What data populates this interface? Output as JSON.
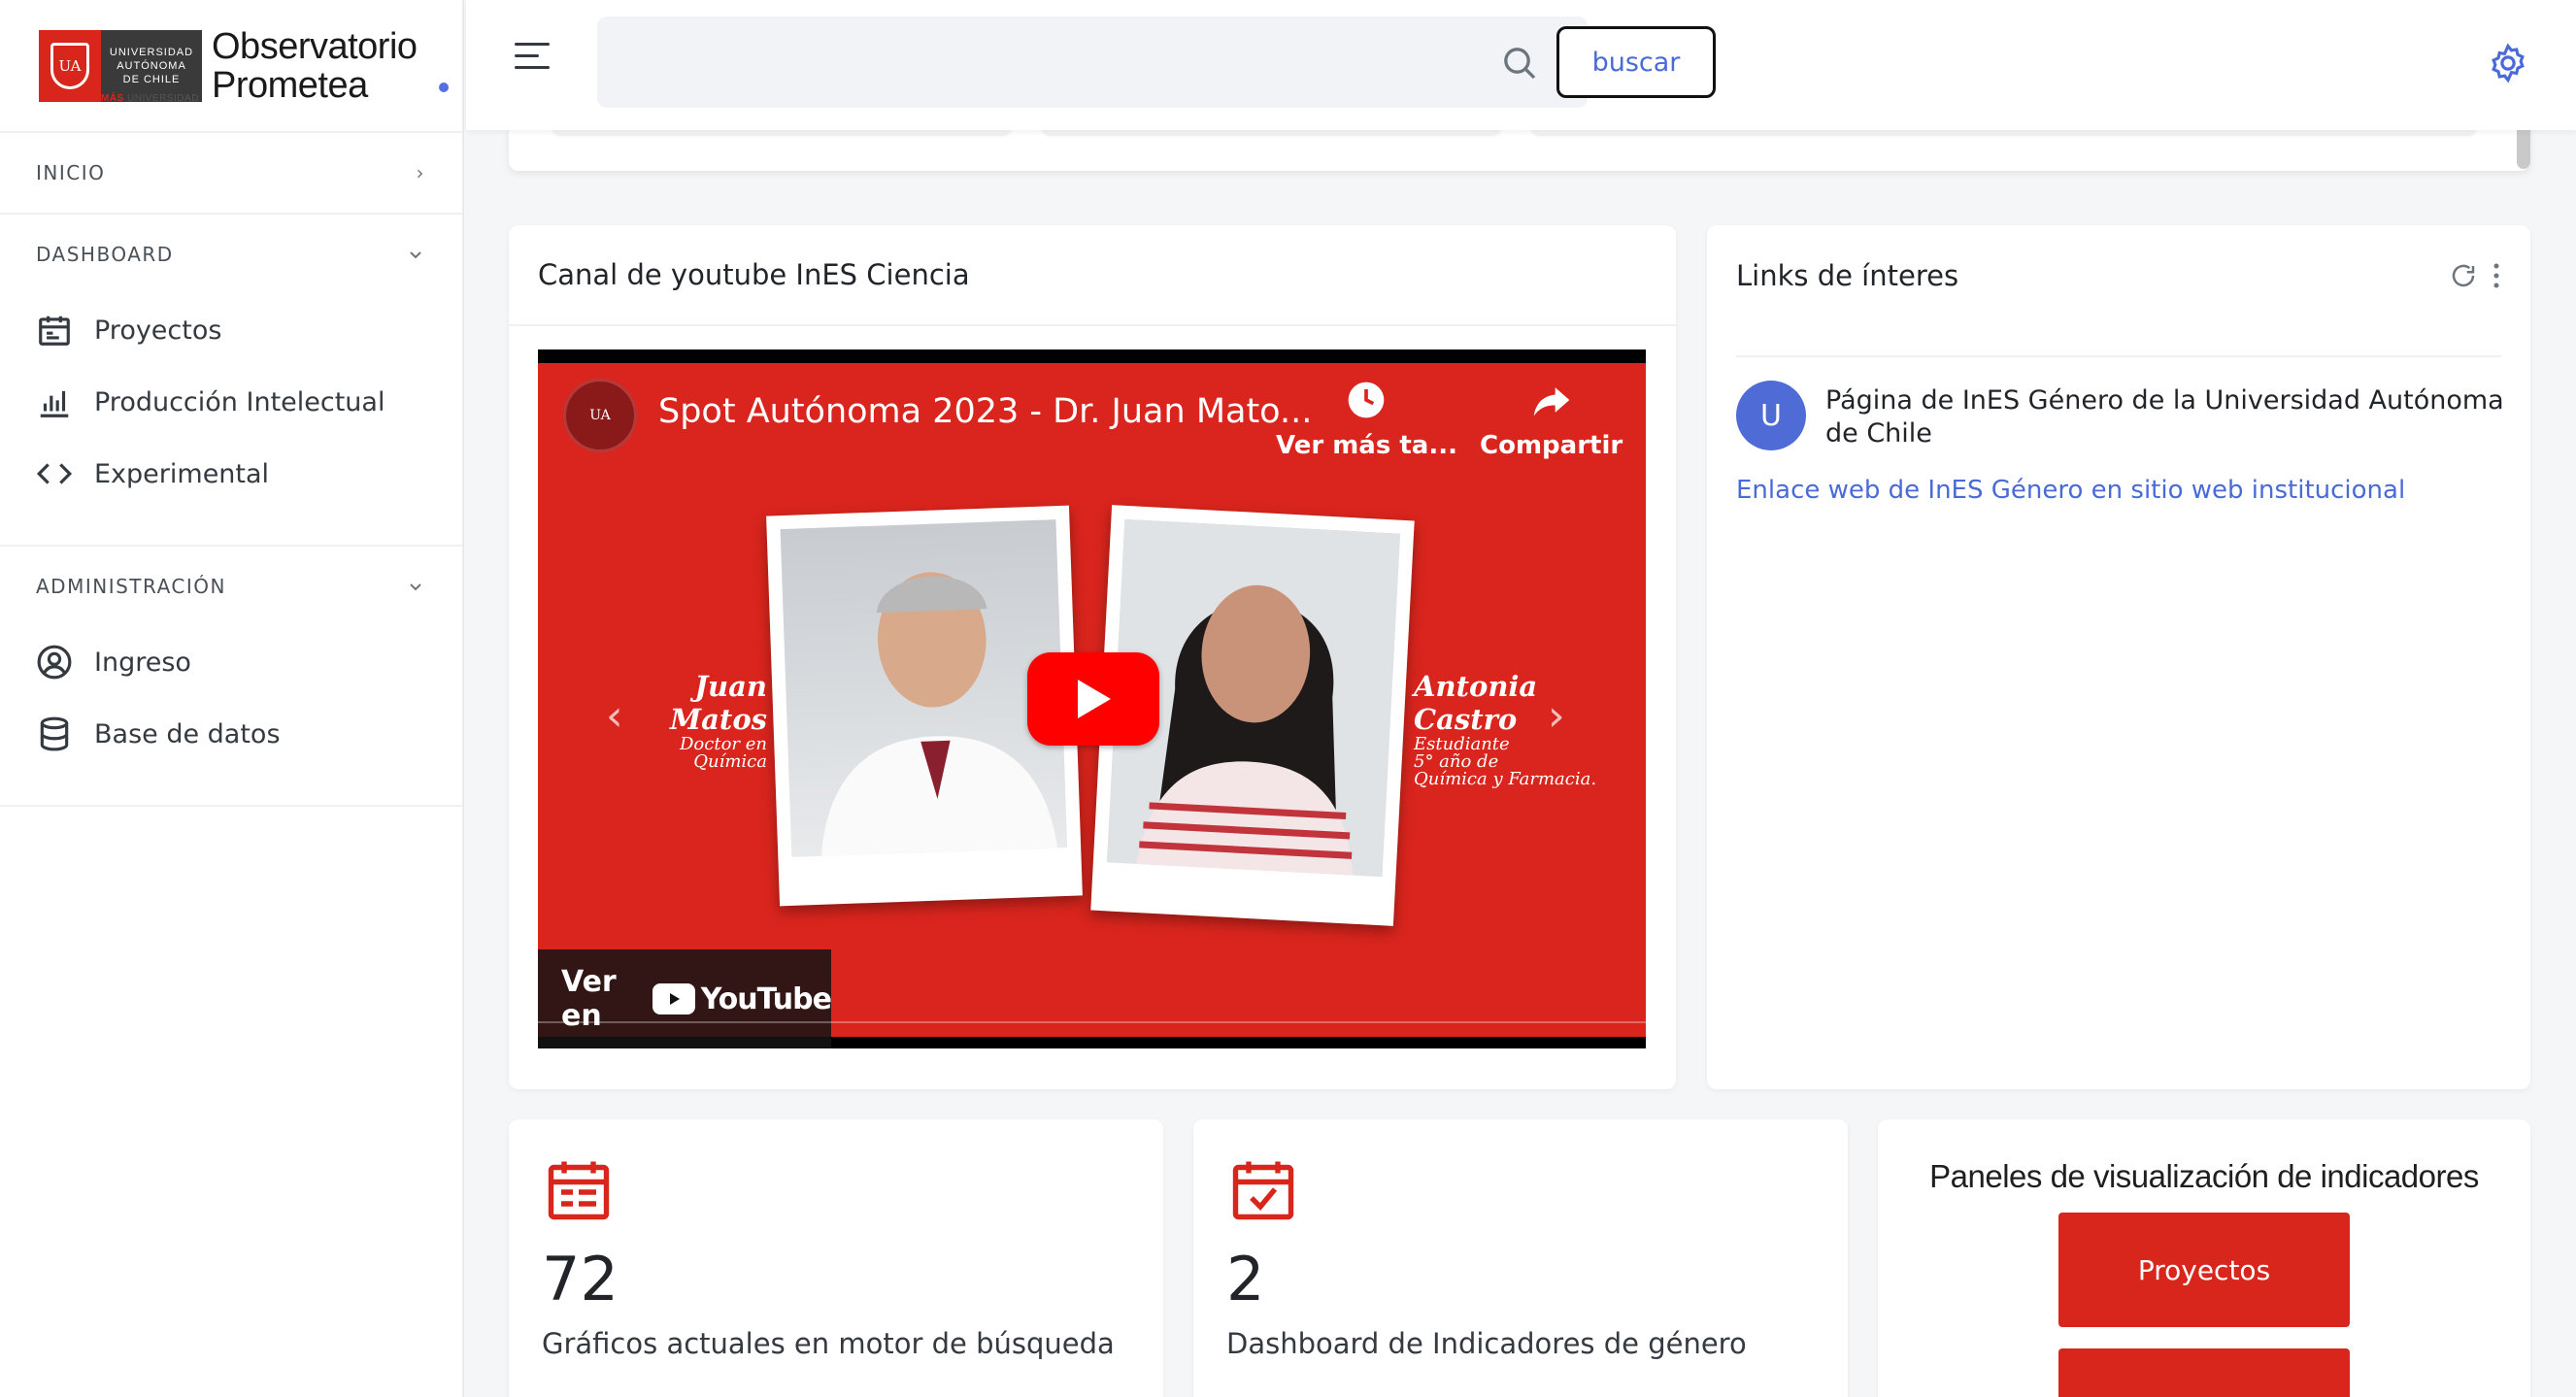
{
  "brand": {
    "logo_lines": [
      "UNIVERSIDAD",
      "AUTÓNOMA",
      "DE CHILE"
    ],
    "logo_tagline_strong": "MÁS",
    "logo_tagline": "UNIVERSIDAD",
    "logo_initials": "UA",
    "title_line1": "Observatorio",
    "title_line2": "Prometea"
  },
  "sidebar": {
    "inicio": "INICIO",
    "dashboard": {
      "label": "DASHBOARD",
      "items": [
        {
          "label": "Proyectos",
          "icon": "calendar-icon"
        },
        {
          "label": "Producción Intelectual",
          "icon": "bar-chart-icon"
        },
        {
          "label": "Experimental",
          "icon": "code-icon"
        }
      ]
    },
    "admin": {
      "label": "ADMINISTRACIÓN",
      "items": [
        {
          "label": "Ingreso",
          "icon": "user-circle-icon"
        },
        {
          "label": "Base de datos",
          "icon": "database-icon"
        }
      ]
    }
  },
  "header": {
    "search_placeholder": "",
    "search_button": "buscar"
  },
  "youtube_card": {
    "title": "Canal de youtube InES Ciencia",
    "video_title": "Spot Autónoma 2023 - Dr. Juan Mato...",
    "watch_later": "Ver más ta...",
    "share": "Compartir",
    "left_name": "Juan Matos",
    "left_role": "Doctor en Química",
    "right_name": "Antonia Castro",
    "right_role_lines": [
      "Estudiante",
      "5° año de",
      "Química y Farmacia."
    ],
    "watch_on": "Ver en",
    "youtube_brand": "YouTube"
  },
  "links_card": {
    "title": "Links de ínteres",
    "avatar_letter": "U",
    "item_title": "Página de InES Género de la Universidad Autónoma de Chile",
    "item_link": "Enlace web de InES Género en sitio web institucional"
  },
  "stats": [
    {
      "value": "72",
      "label": "Gráficos actuales en motor de búsqueda",
      "icon": "calendar-list-icon"
    },
    {
      "value": "2",
      "label": "Dashboard de Indicadores de género",
      "icon": "calendar-check-icon"
    }
  ],
  "panels": {
    "title": "Paneles de visualización de indicadores",
    "button1": "Proyectos",
    "button2": ""
  },
  "colors": {
    "accent_red": "#d9261c",
    "link_blue": "#4a6ad8",
    "avatar_blue": "#4f6bd6"
  }
}
